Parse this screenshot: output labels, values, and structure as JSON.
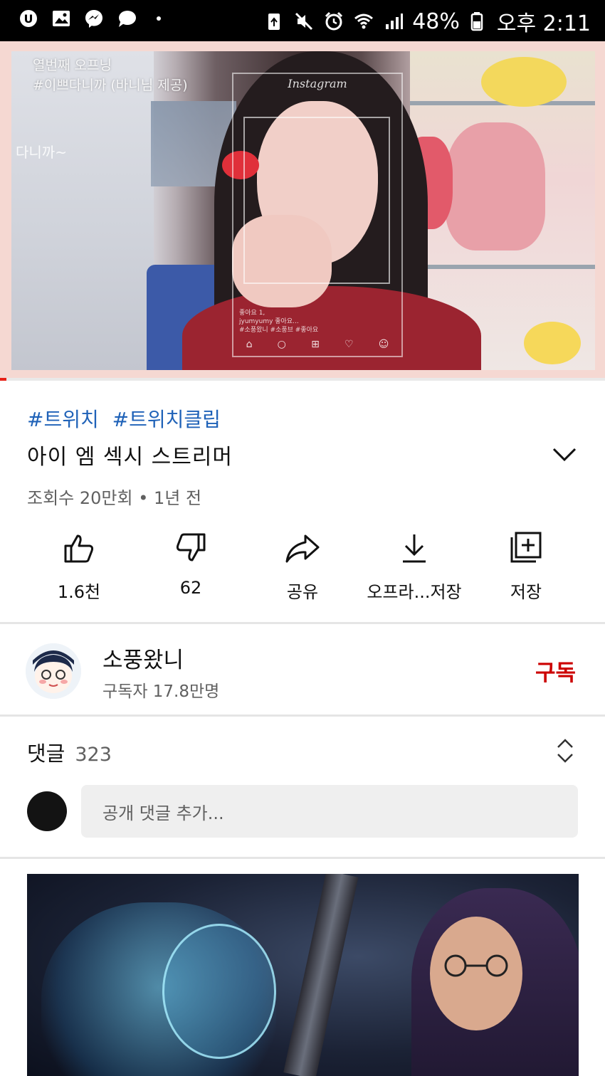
{
  "status_bar": {
    "battery": "48%",
    "time": "오후 2:11",
    "icons_left": [
      "u-plus-icon",
      "gallery-icon",
      "messenger-icon",
      "chat-bubble-icon"
    ],
    "icons_right": [
      "recycle-icon",
      "mute-icon",
      "alarm-icon",
      "wifi-icon",
      "signal-icon",
      "battery-icon"
    ]
  },
  "player": {
    "overlay_line1": "열번째 오프닝",
    "overlay_line2": "#이쁘다니까 (바니님 제공)",
    "overlay_side": "다니까~",
    "instagram_label": "Instagram",
    "instagram_caption_1": "좋아요 1,",
    "instagram_caption_2": "jyumyumy 좋아요...",
    "instagram_caption_3": "#소풍왔니 #소풍브 #좋아요",
    "progress": 0.01,
    "progress_color": "#e62117"
  },
  "video": {
    "hashtags": [
      "#트위치",
      "#트위치클립"
    ],
    "title": "아이 엠 섹시 스트리머",
    "meta": "조회수 20만회 • 1년 전"
  },
  "actions": [
    {
      "icon": "thumbs-up-icon",
      "label": "1.6천"
    },
    {
      "icon": "thumbs-down-icon",
      "label": "62"
    },
    {
      "icon": "share-icon",
      "label": "공유"
    },
    {
      "icon": "download-icon",
      "label": "오프라...저장"
    },
    {
      "icon": "add-to-playlist-icon",
      "label": "저장"
    }
  ],
  "channel": {
    "name": "소풍왔니",
    "subscribers": "구독자 17.8만명",
    "subscribe_label": "구독",
    "subscribe_color": "#cc0000"
  },
  "comments": {
    "label": "댓글",
    "count": "323",
    "placeholder": "공개 댓글 추가..."
  }
}
